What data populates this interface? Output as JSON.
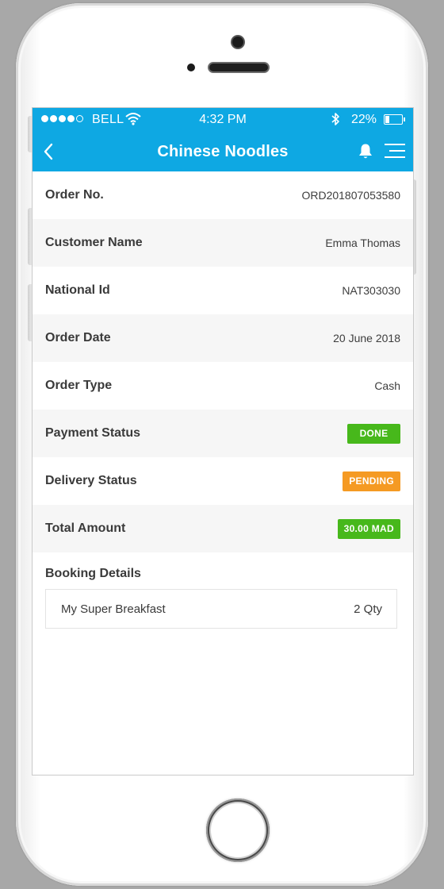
{
  "status_bar": {
    "signal_dots_filled": 4,
    "signal_dots_total": 5,
    "carrier": "BELL",
    "time": "4:32 PM",
    "battery_percent": "22%",
    "battery_level": 0.22,
    "icons": [
      "wifi-icon",
      "bluetooth-icon",
      "battery-icon"
    ]
  },
  "nav": {
    "title": "Chinese Noodles",
    "icons": [
      "chevron-left-icon",
      "bell-icon",
      "menu-icon"
    ]
  },
  "colors": {
    "header": "#0ea8e3",
    "done": "#47b81b",
    "pending": "#f59a23",
    "amount": "#47b81b"
  },
  "order": {
    "rows": [
      {
        "label": "Order No.",
        "value": "ORD201807053580"
      },
      {
        "label": "Customer Name",
        "value": "Emma Thomas"
      },
      {
        "label": "National Id",
        "value": "NAT303030"
      },
      {
        "label": "Order Date",
        "value": "20 June 2018"
      },
      {
        "label": "Order Type",
        "value": "Cash"
      },
      {
        "label": "Payment Status",
        "badge": "DONE"
      },
      {
        "label": "Delivery Status",
        "badge": "PENDING"
      },
      {
        "label": "Total Amount",
        "badge": "30.00 MAD"
      }
    ]
  },
  "booking": {
    "title": "Booking Details",
    "items": [
      {
        "name": "My Super Breakfast",
        "qty": "2 Qty"
      }
    ]
  }
}
